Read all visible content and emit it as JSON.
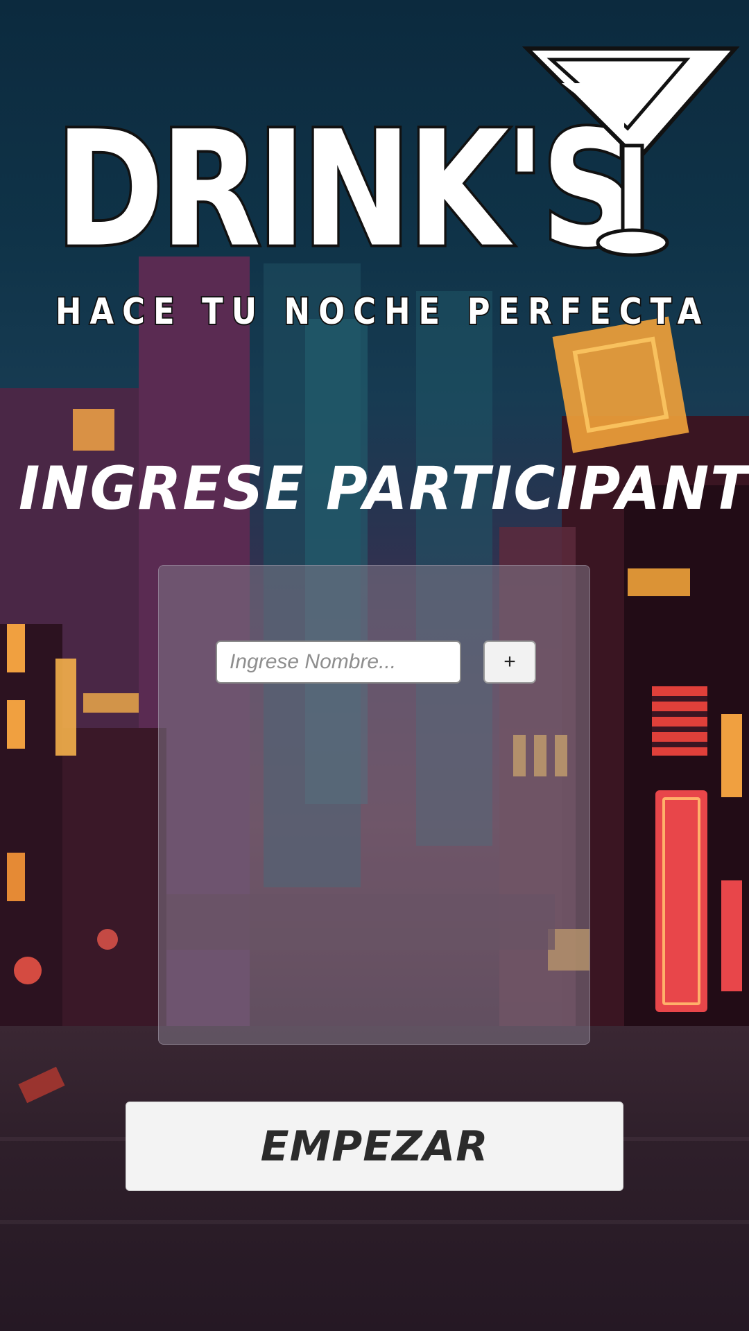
{
  "app": {
    "logo_text": "DRINK'S",
    "tagline": "HACE TU NOCHE PERFECTA"
  },
  "main": {
    "heading": "INGRESE PARTICIPANTES",
    "name_input": {
      "value": "",
      "placeholder": "Ingrese Nombre..."
    },
    "add_button_label": "+",
    "start_button_label": "EMPEZAR"
  },
  "icons": {
    "logo_glass": "cocktail-glass-icon"
  },
  "colors": {
    "heading": "#ffffff",
    "button_bg": "#f3f3f3",
    "button_text": "#2b2b2b",
    "panel": "rgba(128,118,135,0.55)"
  }
}
